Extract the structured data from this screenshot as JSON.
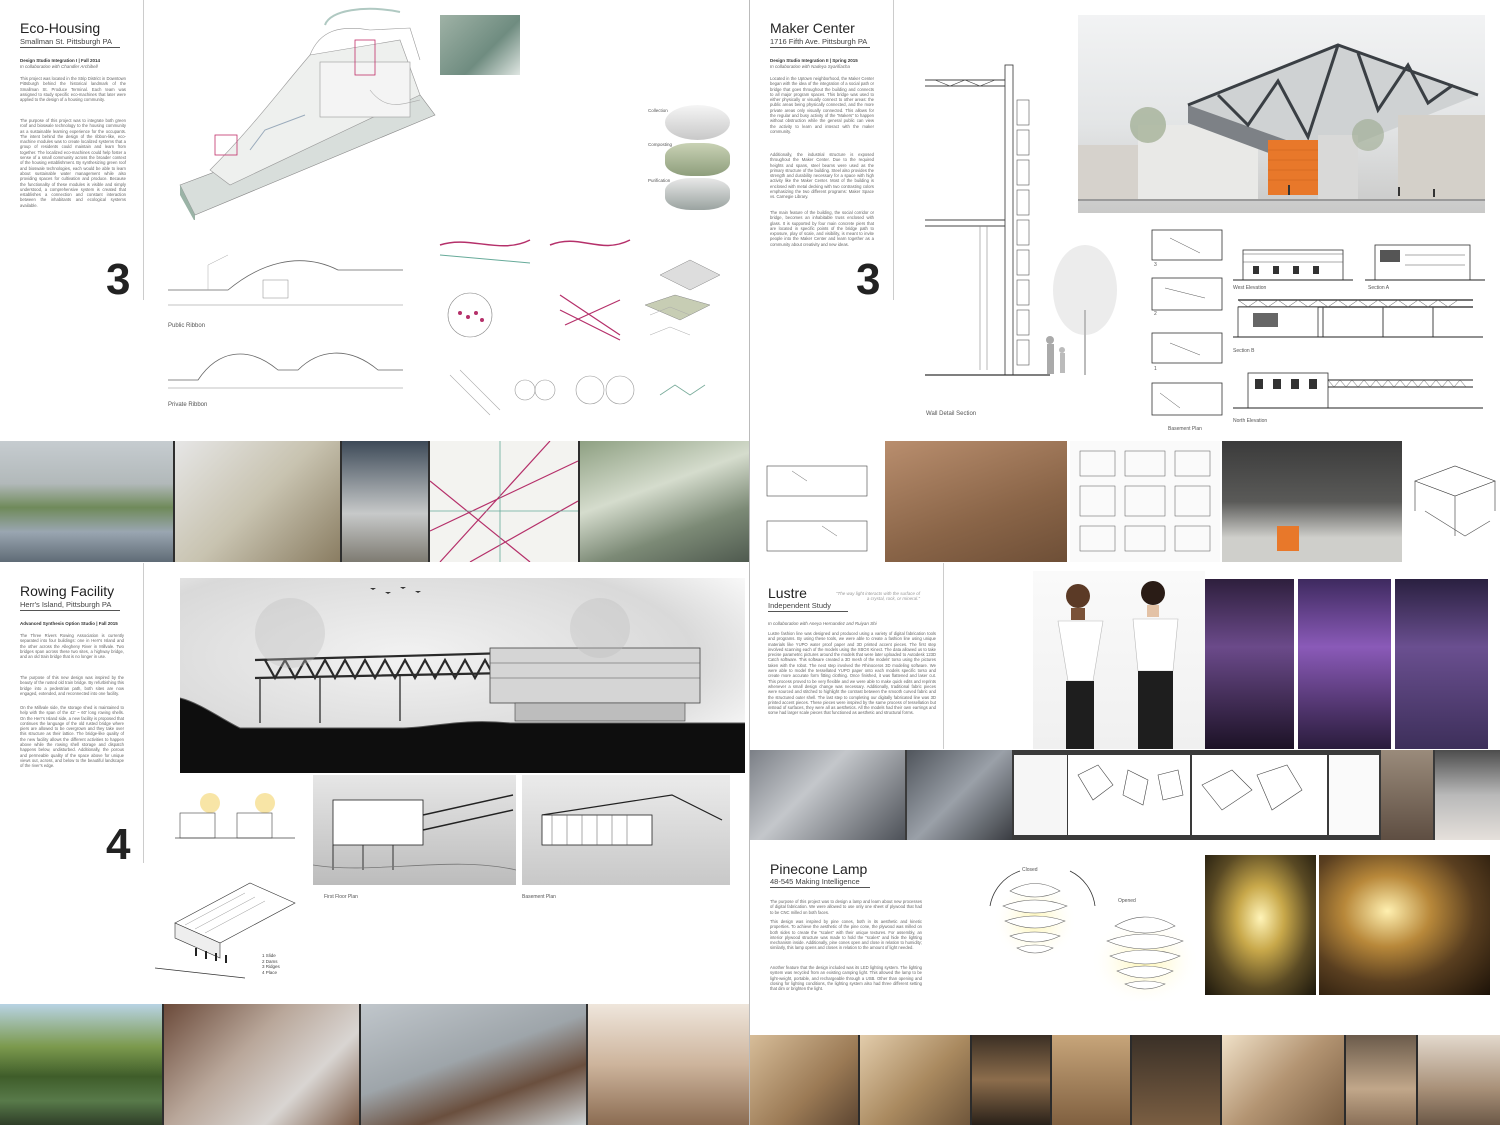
{
  "projects": {
    "eco_housing": {
      "title": "Eco-Housing",
      "location": "Smallman St. Pittsburgh  PA",
      "studio": "Design Studio Integration I | Fall 2014",
      "collab": "In collaboration with Chandler Archibell",
      "body1": "This project was located in the Strip District in Downtown Pittsburgh behind the historical landmark of the Smallman St. Produce Terminal. Each team was assigned to study specific eco-machines that later were applied to the design of a housing community.",
      "body2": "The purpose of this project was to integrate both green roof and bioswale technology to the housing community as a sustainable learning experience for the occupants. The intent behind the design of the ribbon-like, eco-machine modules was to create localized systems that a group of residents could maintain and learn from together. The localized eco-machines could help foster a sense of a small community across the broader context of the housing establishment. By synthesizing green roof and bioswale technologies, each would be able to learn about sustainable water management while also providing spaces for cultivation and produce. Because the functionality of these modules is visible and simply understood, a comprehensive system is created that establishes a connection and constant interaction between the inhabitants and ecological systems available.",
      "number": "3",
      "captions": [
        "Public Ribbon",
        "Private Ribbon"
      ],
      "callouts": [
        "Collection",
        "Composting",
        "Purification"
      ]
    },
    "maker_center": {
      "title": "Maker Center",
      "location": "1716 Fifth Ave. Pittsburgh PA",
      "studio": "Design Studio Integration II | Spring 2015",
      "collab": "In collaboration with Nadeya Syarifiacha",
      "body1": "Located in the Uptown neighborhood, the Maker Center began with the idea of the integration of a social path or bridge that goes throughout the building and connects to all major program spaces. This bridge was used to either physically or visually connect to other areas: the public areas being physically connected, and the more private areas only visually connected. This allows for the regular and busy activity of the \"Makers\" to happen without obstruction while the general public can view the activity to learn and interact with the maker community.",
      "body2": "Additionally, the industrial structure is exposed throughout the Maker Center. Due to the required heights and spans, steel beams were used as the primary structure of the building. Steel also provides the strength and durability necessary for a space with high activity like the Maker Center. Most of the building is enclosed with metal decking with two contrasting colors emphasizing the two different programs: Maker Space vs. Carnegie Library.",
      "body3": "The main feature of the building, the social corridor or bridge, becomes an inhabitable truss enclosed with glass. It is supported by four main concrete piers that are located in specific points of the bridge path to exposure, play of scale, and visibility, is meant to invite people into the Maker Center and learn together as a community about creativity and new ideas.",
      "number": "3",
      "captions": [
        "Wall Detail Section",
        "West Elevation",
        "Section A",
        "Section B",
        "North Elevation",
        "Basement Plan"
      ],
      "levels": [
        "3",
        "2",
        "1"
      ]
    },
    "rowing": {
      "title": "Rowing Facility",
      "location": "Herr's Island, Pittsburgh PA",
      "studio": "Advanced Synthesis Option Studio | Fall 2015",
      "body1": "The Three Rivers Rowing Association is currently separated into four buildings: one in Herr's Island and the other across the Allegheny River in Millvale. Two bridges span across these two sites, a highway bridge, and an old train bridge that is no longer in use.",
      "body2": "The purpose of this new design was inspired by the beauty of the rusted old train bridge. By refurbishing this bridge into a pedestrian path, both sites are now engaged, extended, and reconnected into one facility.",
      "body3": "On the Millvale side, the storage shed is maintained to help with the span of the 42' ~ 60' long rowing shells. On the Herr's Island side, a new facility is proposed that continues the language of the old rusted bridge where piers are allowed to be overgrown and they take over this structure as their lattice. The bridge-like quality of the new facility allows the different activities to happen above while the rowing shell storage and dispatch happens below, undisturbed. Additionally, the porous and permeable quality of the space above for unique views out, across, and below to the beautiful landscape of the river's edge.",
      "number": "4",
      "captions": [
        "First Floor Plan",
        "Basement Plan"
      ],
      "legend": [
        "1 Slide",
        "2 Dams",
        "3 Ridges",
        "4 Place"
      ]
    },
    "lustre": {
      "title": "Lustre",
      "subtitle": "Independent Study",
      "collab": "In collaboration with Aneya Hernandez and Ruiyan Shi",
      "quote": "\"The way light interacts with the surface of a crystal, rock, or mineral.\"",
      "body": "Lustre fashion line was designed and produced using a variety of digital fabrication tools and programs. By using these tools, we were able to create a fashion line using unique materials like YUPO water proof paper and 3D printed accent pieces. The first step involved scanning each of the models using the XBOX Kinect. The data allowed us to take precise parametric pictures around the models that were later uploaded to Autodesk 123D Catch software. This software created a 3D mesh of the models' torso using the pictures taken with the robot. The next step involved the Rhinoceros 3D modeling software. We were able to model the tessellated YUPO paper onto each models specific torso and create more accurate form fitting clothing. Once finished, it was flattened and laser cut. This process proved to be very flexible and we were able to make quick edits and reprints whenever a small design change was necessary. Additionally, traditional fabric pieces were sourced and stitched to highlight the contrast between the smooth curved fabric and the structured outer shell. The last step to completing our digitally fabricated line was 3D printed accent pieces. These pieces were inspired by the same process of tessellation but instead of surfaces, they were all as aesthetics. All the models had their own earrings and some had larger scale pieces that functioned as aesthetic and structural forms."
    },
    "pinecone": {
      "title": "Pinecone Lamp",
      "subtitle": "48-545 Making Intelligence",
      "body1": "The purpose of this project was to design a lamp and learn about new processes of digital fabrication. We were allowed to use only one sheet of plywood that had to be CNC milled on both faces.",
      "body2": "This design was inspired by pine cones, both in its aesthetic and kinetic properties. To achieve the aesthetic of the pine cone, the plywood was milled on both sides to create the \"scales\" with their unique textures. For assembly, an interior plywood structure was made to hold the \"scales\" and hide the lighting mechanism inside. Additionally, pine cones open and close in relation to humidity; similarly, this lamp opens and closes in relation to the amount of light needed.",
      "body3": "Another feature that the design included was its LED lighting system. The lighting system was recycled from an existing camping light. This allowed the lamp to be light-weight, portable, and rechargeable through a USB. Other than opening and closing for lighting conditions, the lighting system also had three different setting that dim or brighten the light.",
      "labels": [
        "Closed",
        "Opened"
      ]
    }
  },
  "colors": {
    "orange_accent": "#e8782a",
    "diagram_magenta": "#b5306a",
    "strip_dark": "#2e2e2e",
    "text_dark": "#222222"
  }
}
